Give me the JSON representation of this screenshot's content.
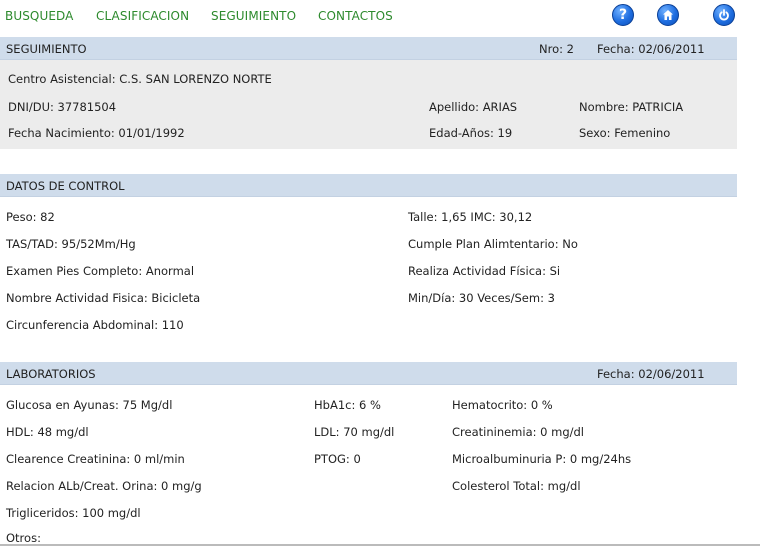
{
  "nav": {
    "items": [
      "BUSQUEDA",
      "CLASIFICACION",
      "SEGUIMIENTO",
      "CONTACTOS"
    ],
    "icons": [
      "help-icon",
      "home-icon",
      "power-icon"
    ],
    "color": "#2d8a2d"
  },
  "seguimiento": {
    "title": "SEGUIMIENTO",
    "nro": "Nro: 2",
    "fecha": "Fecha: 02/06/2011",
    "centro": "Centro Asistencial: C.S. SAN LORENZO NORTE",
    "dni": "DNI/DU: 37781504",
    "apellido": "Apellido: ARIAS",
    "nombre": "Nombre: PATRICIA",
    "fecha_nac": "Fecha Nacimiento: 01/01/1992",
    "edad": "Edad-Años: 19",
    "sexo": "Sexo: Femenino"
  },
  "control": {
    "title": "DATOS DE CONTROL",
    "peso": "Peso: 82",
    "talle_imc": "Talle: 1,65   IMC: 30,12",
    "tas": "TAS/TAD: 95/52Mm/Hg",
    "plan": "Cumple Plan Alimtentario: No",
    "pies": "Examen Pies Completo: Anormal",
    "actividad": "Realiza Actividad Física: Si",
    "nombre_act": "Nombre Actividad Fisica: Bicicleta",
    "min_dia": "Min/Día: 30    Veces/Sem: 3",
    "circ": "Circunferencia Abdominal: 110"
  },
  "laboratorios": {
    "title": "LABORATORIOS",
    "fecha": "Fecha: 02/06/2011",
    "glucosa": "Glucosa en Ayunas: 75 Mg/dl",
    "hba1c": "HbA1c: 6 %",
    "hematocrito": "Hematocrito: 0 %",
    "hdl": "HDL: 48 mg/dl",
    "ldl": "LDL: 70 mg/dl",
    "creatininemia": "Creatininemia: 0 mg/dl",
    "clearence": "Clearence Creatinina: 0 ml/min",
    "ptog": "PTOG: 0",
    "microalb": "Microalbuminuria P: 0 mg/24hs",
    "relacion": "Relacion ALb/Creat. Orina: 0 mg/g",
    "colesterol": "Colesterol Total: mg/dl",
    "triglic": "Trigliceridos: 100 mg/dl",
    "otros": "Otros:"
  },
  "colors": {
    "header_bg": "#cfdceb",
    "panel_bg": "#ececec",
    "icon_blue": "#1f6ee0"
  }
}
